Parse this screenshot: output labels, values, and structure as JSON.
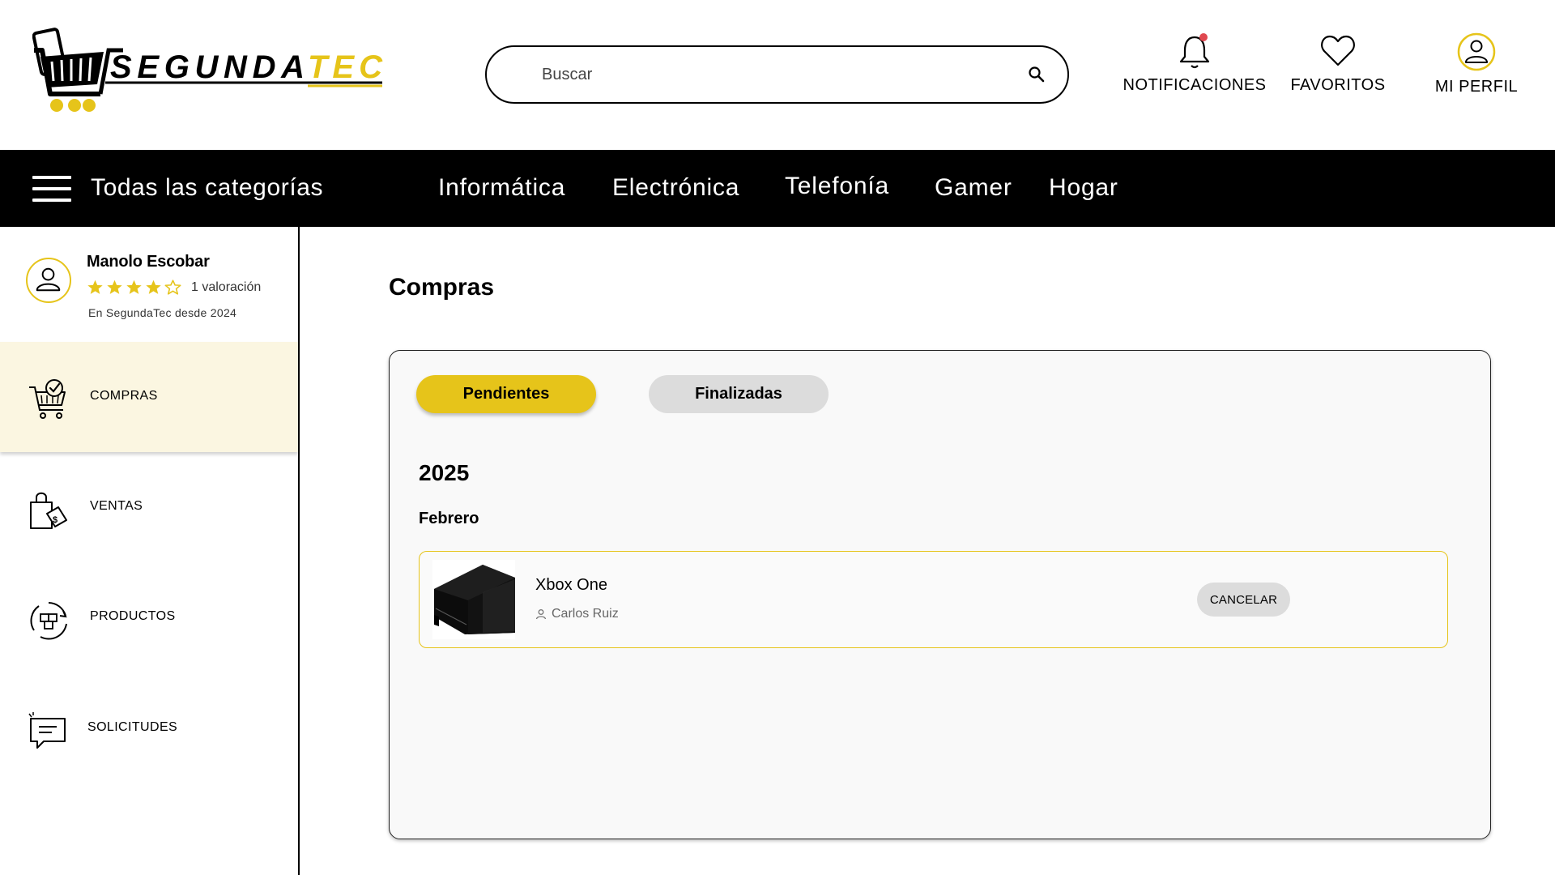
{
  "brand": {
    "logo_text": "SEGUNDATEC",
    "colors": {
      "accent": "#e6c41a",
      "dark": "#000000",
      "active_bg": "#fbf6e1",
      "notification_dot": "#e0484f"
    }
  },
  "header": {
    "search_placeholder": "Buscar",
    "actions": {
      "notifications": "NOTIFICACIONES",
      "favorites": "FAVORITOS",
      "profile": "MI PERFIL"
    }
  },
  "categories": {
    "all_label": "Todas las categorías",
    "items": [
      "Informática",
      "Electrónica",
      "Telefonía",
      "Gamer",
      "Hogar"
    ]
  },
  "user": {
    "name": "Manolo Escobar",
    "rating": 4,
    "rating_max": 5,
    "rating_count": "1 valoración",
    "member_since": "En SegundaTec desde 2024"
  },
  "sidebar": {
    "items": [
      {
        "label": "COMPRAS",
        "icon": "cart-check-icon",
        "active": true
      },
      {
        "label": "VENTAS",
        "icon": "shopping-bag-dollar-icon",
        "active": false
      },
      {
        "label": "PRODUCTOS",
        "icon": "boxes-cycle-icon",
        "active": false
      },
      {
        "label": "SOLICITUDES",
        "icon": "message-icon",
        "active": false
      }
    ]
  },
  "main": {
    "title": "Compras",
    "tabs": {
      "pending": "Pendientes",
      "finished": "Finalizadas",
      "active": "pending"
    },
    "groups": [
      {
        "year": "2025",
        "month": "Febrero",
        "orders": [
          {
            "product": "Xbox One",
            "seller": "Carlos Ruiz",
            "action": "CANCELAR"
          }
        ]
      }
    ]
  }
}
